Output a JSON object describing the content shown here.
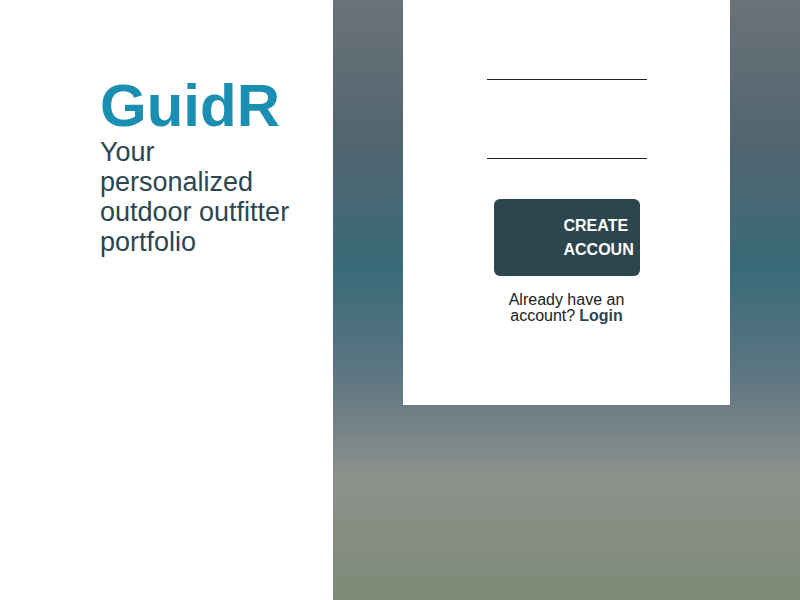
{
  "brand": {
    "title": "GuidR",
    "tagline": "Your personalized outdoor outfitter portfolio"
  },
  "form": {
    "fields": [
      {
        "value": ""
      },
      {
        "value": ""
      }
    ],
    "button": "CREATE ACCOUN",
    "prompt": {
      "text": "Already have an account?",
      "link": "Login"
    }
  }
}
